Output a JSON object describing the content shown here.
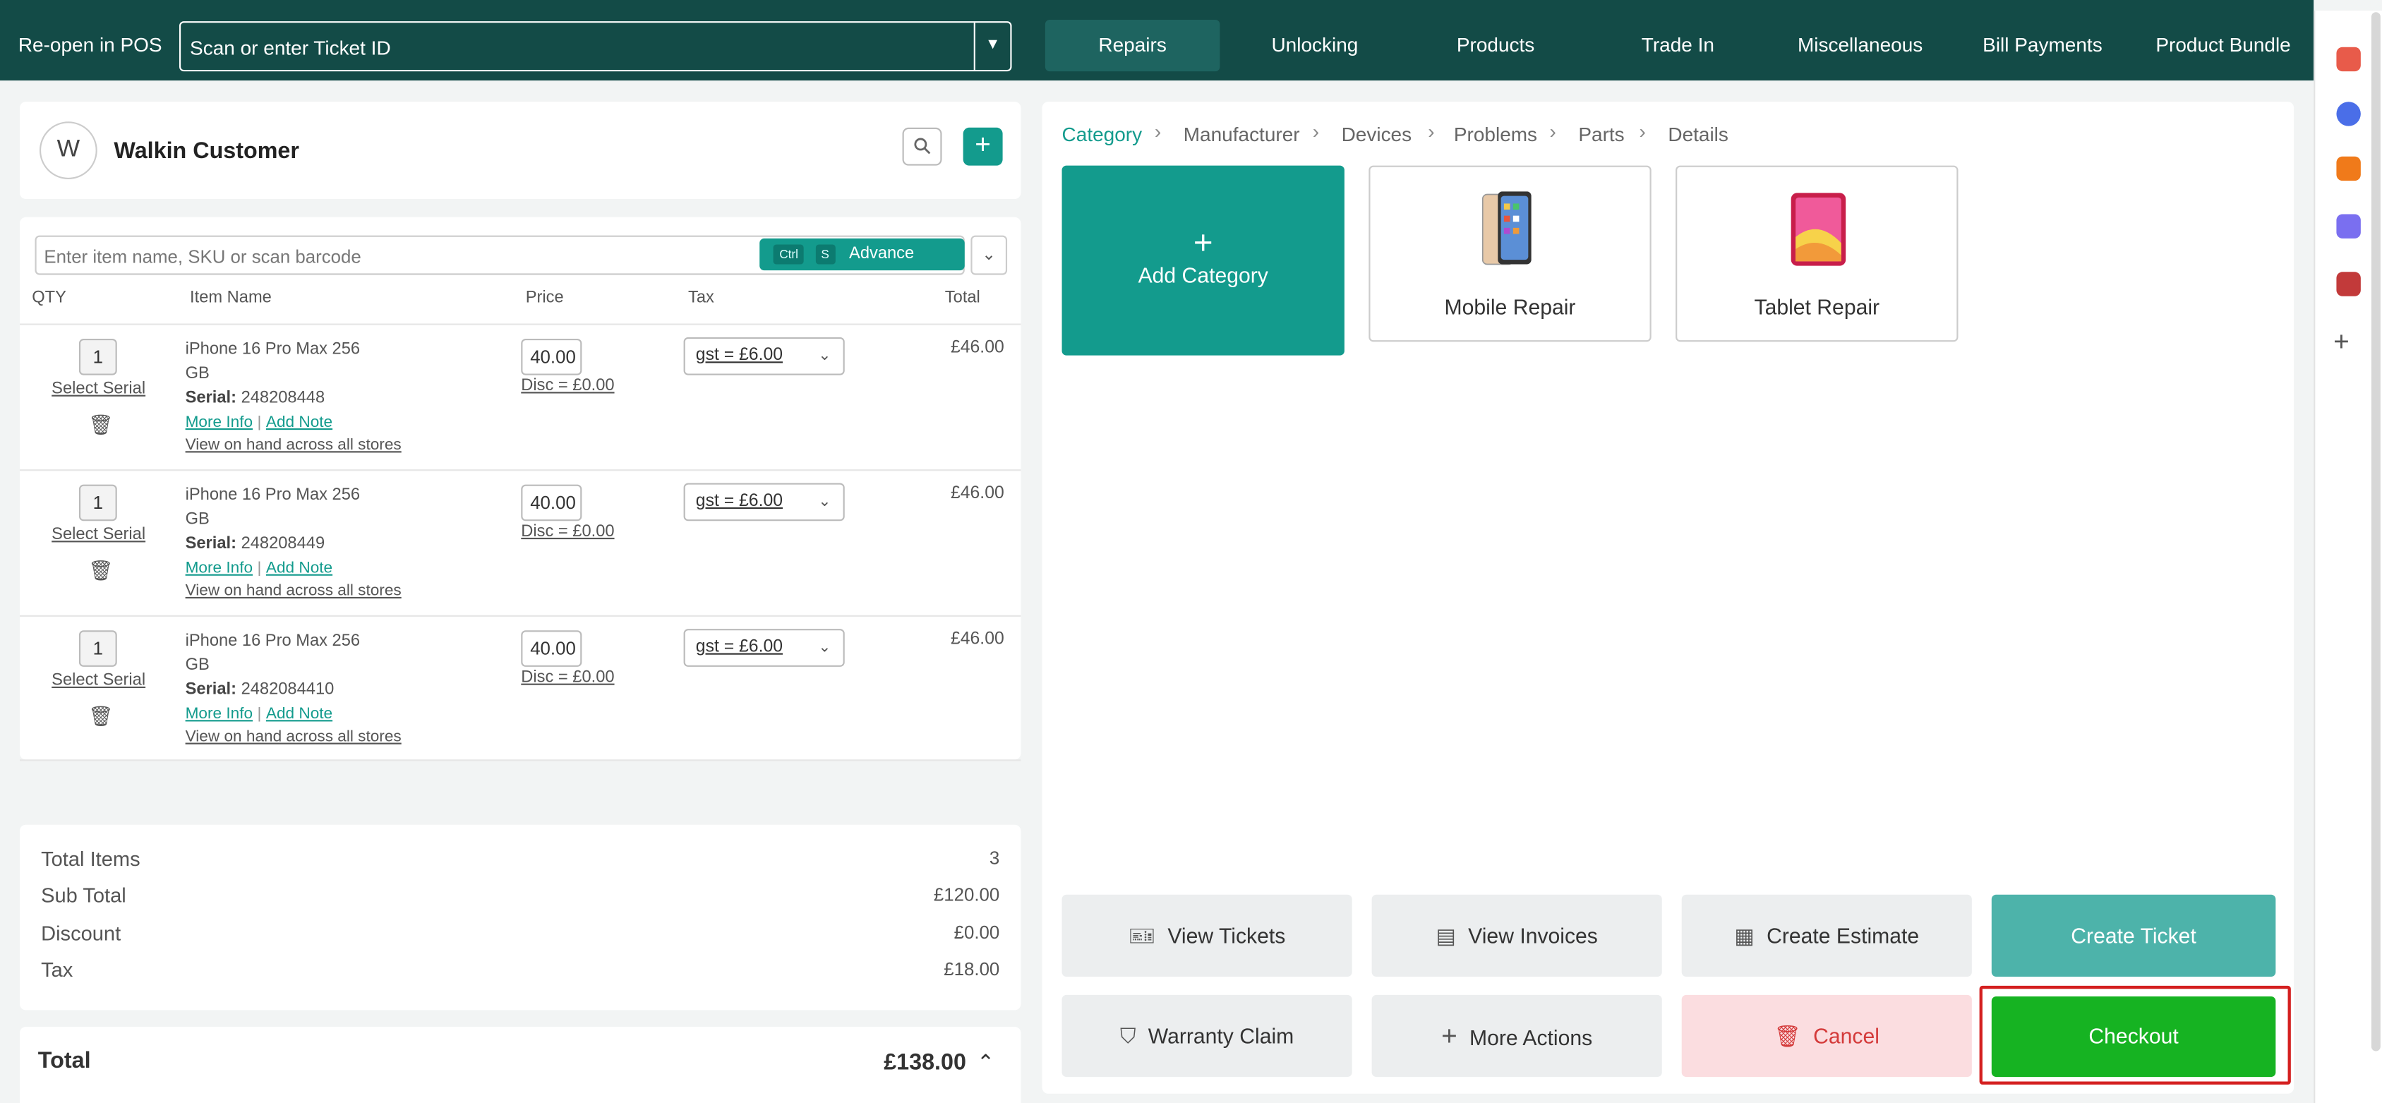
{
  "topbar": {
    "reopen_label": "Re-open in POS",
    "scan_placeholder": "Scan or enter Ticket ID",
    "tabs": [
      {
        "label": "Repairs",
        "active": true
      },
      {
        "label": "Unlocking"
      },
      {
        "label": "Products"
      },
      {
        "label": "Trade In"
      },
      {
        "label": "Miscellaneous"
      },
      {
        "label": "Bill Payments"
      },
      {
        "label": "Product Bundle"
      }
    ]
  },
  "customer": {
    "avatar_letter": "W",
    "name": "Walkin Customer"
  },
  "item_search": {
    "placeholder": "Enter item name, SKU or scan barcode",
    "kbd_ctrl": "Ctrl",
    "kbd_s": "S",
    "advance_label": "Advance Search"
  },
  "table": {
    "headers": {
      "qty": "QTY",
      "name": "Item Name",
      "price": "Price",
      "tax": "Tax",
      "total": "Total"
    },
    "rows": [
      {
        "qty": "1",
        "select_serial": "Select Serial",
        "name": "iPhone 16 Pro Max 256 GB",
        "serial_label": "Serial:",
        "serial": "248208448",
        "more_info": "More Info",
        "add_note": "Add Note",
        "on_hand": "View on hand across all stores",
        "price": "40.00",
        "disc": "Disc = £0.00",
        "tax": "gst = £6.00",
        "total": "£46.00"
      },
      {
        "qty": "1",
        "select_serial": "Select Serial",
        "name": "iPhone 16 Pro Max 256 GB",
        "serial_label": "Serial:",
        "serial": "248208449",
        "more_info": "More Info",
        "add_note": "Add Note",
        "on_hand": "View on hand across all stores",
        "price": "40.00",
        "disc": "Disc = £0.00",
        "tax": "gst = £6.00",
        "total": "£46.00"
      },
      {
        "qty": "1",
        "select_serial": "Select Serial",
        "name": "iPhone 16 Pro Max 256 GB",
        "serial_label": "Serial:",
        "serial": "2482084410",
        "more_info": "More Info",
        "add_note": "Add Note",
        "on_hand": "View on hand across all stores",
        "price": "40.00",
        "disc": "Disc = £0.00",
        "tax": "gst = £6.00",
        "total": "£46.00"
      }
    ]
  },
  "summary": {
    "total_items_label": "Total Items",
    "total_items": "3",
    "subtotal_label": "Sub Total",
    "subtotal": "£120.00",
    "discount_label": "Discount",
    "discount": "£0.00",
    "tax_label": "Tax",
    "tax": "£18.00",
    "total_label": "Total",
    "total": "£138.00"
  },
  "breadcrumb": [
    "Category",
    "Manufacturer",
    "Devices",
    "Problems",
    "Parts",
    "Details"
  ],
  "tiles": {
    "add_category": "Add Category",
    "mobile_repair": "Mobile Repair",
    "tablet_repair": "Tablet Repair"
  },
  "actions": {
    "view_tickets": "View Tickets",
    "view_invoices": "View Invoices",
    "create_estimate": "Create Estimate",
    "create_ticket": "Create Ticket",
    "warranty_claim": "Warranty Claim",
    "more_actions": "More Actions",
    "cancel": "Cancel",
    "checkout": "Checkout"
  },
  "colors": {
    "topbar": "#134b47",
    "accent": "#139b8d",
    "checkout": "#16b322",
    "cancel_bg": "#fbdde0",
    "highlight": "#d42020"
  }
}
